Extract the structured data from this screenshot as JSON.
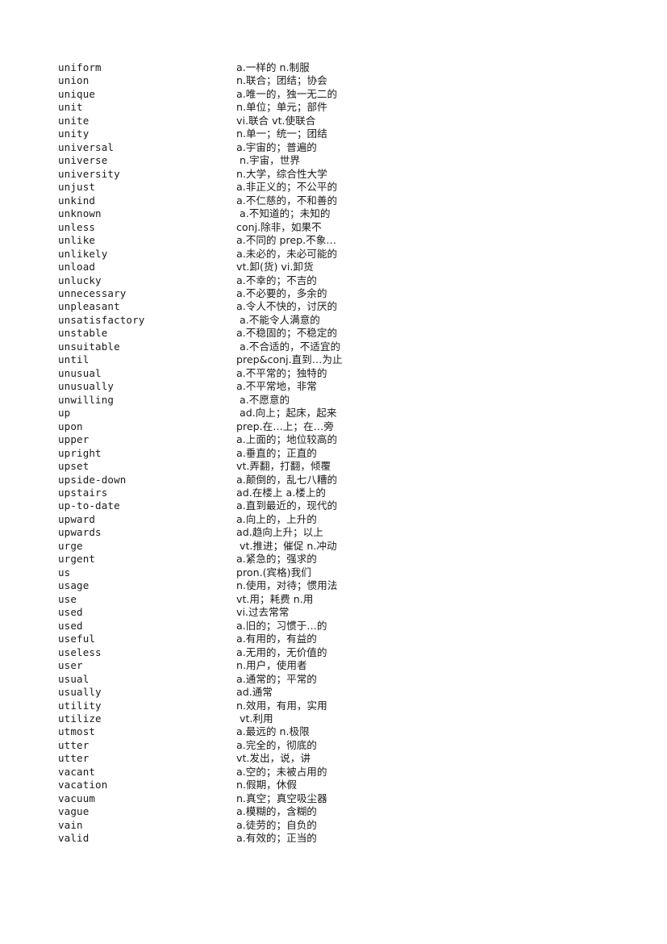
{
  "page": {
    "background_color": "#ffffff",
    "text_color": "#1a1a1a",
    "kind": "vocabulary-list",
    "columns": [
      "word",
      "definition"
    ]
  },
  "entries": [
    {
      "word": "uniform",
      "definition": "a.一样的 n.制服"
    },
    {
      "word": "union",
      "definition": "n.联合；团结；协会"
    },
    {
      "word": "unique",
      "definition": "a.唯一的，独一无二的"
    },
    {
      "word": "unit",
      "definition": "n.单位；单元；部件"
    },
    {
      "word": "unite",
      "definition": "vi.联合 vt.使联合"
    },
    {
      "word": "unity",
      "definition": "n.单一；统一；团结"
    },
    {
      "word": "universal",
      "definition": "a.宇宙的；普遍的"
    },
    {
      "word": "universe",
      "definition": " n.宇宙，世界"
    },
    {
      "word": "university",
      "definition": "n.大学，综合性大学"
    },
    {
      "word": "unjust",
      "definition": "a.非正义的；不公平的"
    },
    {
      "word": "unkind",
      "definition": "a.不仁慈的，不和善的"
    },
    {
      "word": "unknown",
      "definition": " a.不知道的；未知的"
    },
    {
      "word": "unless",
      "definition": "conj.除非，如果不"
    },
    {
      "word": "unlike",
      "definition": "a.不同的 prep.不象…"
    },
    {
      "word": "unlikely",
      "definition": "a.未必的，未必可能的"
    },
    {
      "word": "unload",
      "definition": "vt.卸(货) vi.卸货"
    },
    {
      "word": "unlucky",
      "definition": "a.不幸的；不吉的"
    },
    {
      "word": "unnecessary",
      "definition": "a.不必要的，多余的"
    },
    {
      "word": "unpleasant",
      "definition": "a.令人不快的，讨厌的"
    },
    {
      "word": "unsatisfactory",
      "definition": " a.不能令人满意的"
    },
    {
      "word": "unstable",
      "definition": "a.不稳固的；不稳定的"
    },
    {
      "word": "unsuitable",
      "definition": " a.不合适的，不适宜的"
    },
    {
      "word": "until",
      "definition": "prep&conj.直到…为止"
    },
    {
      "word": "unusual",
      "definition": "a.不平常的；独特的"
    },
    {
      "word": "unusually",
      "definition": "a.不平常地，非常"
    },
    {
      "word": "unwilling",
      "definition": " a.不愿意的"
    },
    {
      "word": "up",
      "definition": " ad.向上；起床，起来"
    },
    {
      "word": "upon",
      "definition": "prep.在…上；在…旁"
    },
    {
      "word": "upper",
      "definition": "a.上面的；地位较高的"
    },
    {
      "word": "upright",
      "definition": "a.垂直的；正直的"
    },
    {
      "word": "upset",
      "definition": "vt.弄翻，打翻，倾覆"
    },
    {
      "word": "upside-down",
      "definition": "a.颠倒的，乱七八糟的"
    },
    {
      "word": "upstairs",
      "definition": "ad.在楼上 a.楼上的"
    },
    {
      "word": "up-to-date",
      "definition": "a.直到最近的，现代的"
    },
    {
      "word": "upward",
      "definition": "a.向上的，上升的"
    },
    {
      "word": "upwards",
      "definition": "ad.趋向上升；以上"
    },
    {
      "word": "urge",
      "definition": " vt.推进；催促 n.冲动"
    },
    {
      "word": "urgent",
      "definition": "a.紧急的；强求的"
    },
    {
      "word": "us",
      "definition": "pron.(宾格)我们"
    },
    {
      "word": "usage",
      "definition": "n.使用，对待；惯用法"
    },
    {
      "word": "use",
      "definition": "vt.用；耗费 n.用"
    },
    {
      "word": "used",
      "definition": "vi.过去常常"
    },
    {
      "word": "used",
      "definition": "a.旧的；习惯于…的"
    },
    {
      "word": "useful",
      "definition": "a.有用的，有益的"
    },
    {
      "word": "useless",
      "definition": "a.无用的，无价值的"
    },
    {
      "word": "user",
      "definition": "n.用户，使用者"
    },
    {
      "word": "usual",
      "definition": "a.通常的；平常的"
    },
    {
      "word": "usually",
      "definition": "ad.通常"
    },
    {
      "word": "utility",
      "definition": "n.效用，有用，实用"
    },
    {
      "word": "utilize",
      "definition": " vt.利用"
    },
    {
      "word": "utmost",
      "definition": "a.最远的 n.极限"
    },
    {
      "word": "utter",
      "definition": "a.完全的，彻底的"
    },
    {
      "word": "utter",
      "definition": "vt.发出，说，讲"
    },
    {
      "word": "vacant",
      "definition": "a.空的；未被占用的"
    },
    {
      "word": "vacation",
      "definition": "n.假期，休假"
    },
    {
      "word": "vacuum",
      "definition": "n.真空；真空吸尘器"
    },
    {
      "word": "vague",
      "definition": "a.模糊的，含糊的"
    },
    {
      "word": "vain",
      "definition": "a.徒劳的；自负的"
    },
    {
      "word": "valid",
      "definition": "a.有效的；正当的"
    }
  ]
}
